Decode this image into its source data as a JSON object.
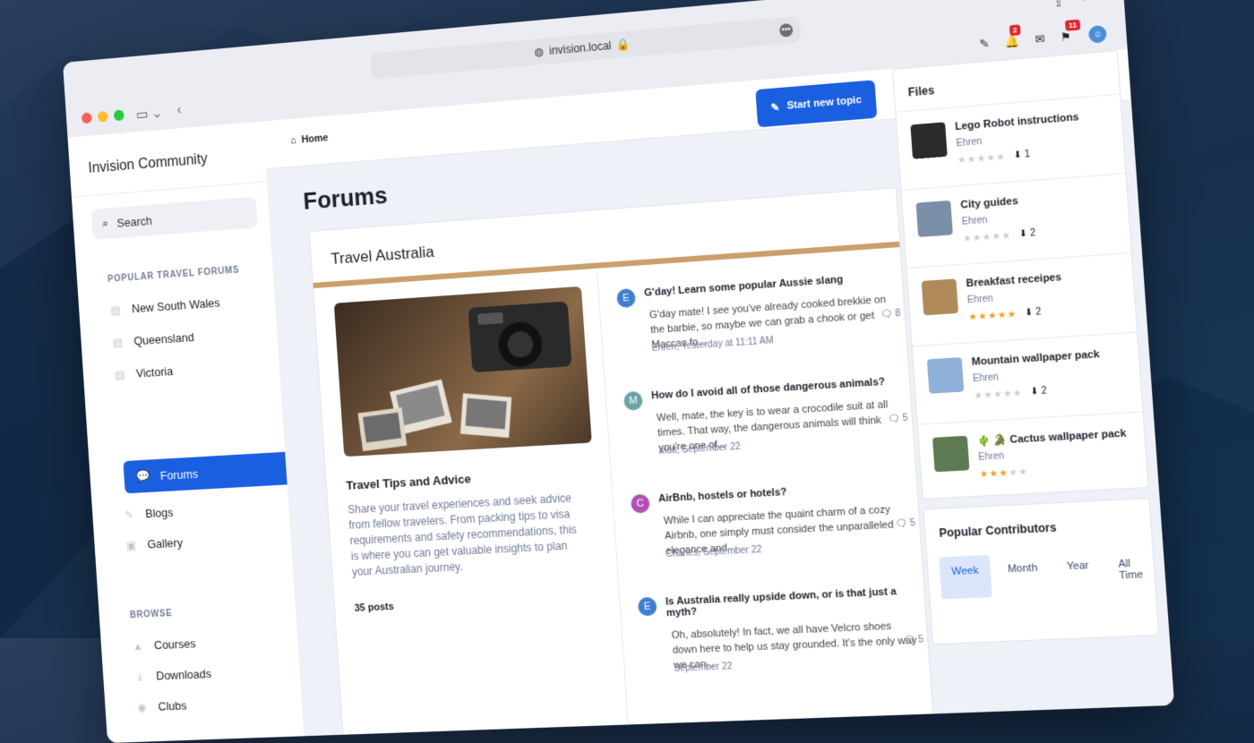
{
  "browser": {
    "url": "invision.local",
    "notifications_count": "2",
    "messages_count": "11"
  },
  "sidebar": {
    "brand": "Invision Community",
    "search_placeholder": "Search",
    "popular_heading": "POPULAR TRAVEL FORUMS",
    "popular": [
      "New South Wales",
      "Queensland",
      "Victoria"
    ],
    "primary": [
      "Forums",
      "Blogs",
      "Gallery"
    ],
    "browse_heading": "BROWSE",
    "browse": [
      "Courses",
      "Downloads",
      "Clubs"
    ]
  },
  "main": {
    "breadcrumb": "Home",
    "start_topic": "Start new topic",
    "page_title": "Forums",
    "category": "Travel Australia",
    "forum": {
      "name": "Travel Tips and Advice",
      "description": "Share your travel experiences and seek advice from fellow travelers. From packing tips to visa requirements and safety recommendations, this is where you can get valuable insights to plan your Australian journey.",
      "posts": "35 posts"
    },
    "topics": [
      {
        "title": "G'day! Learn some popular Aussie slang",
        "excerpt": "G'day mate! I see you've already cooked brekkie on the barbie, so maybe we can grab a chook or get Maccas fo...",
        "meta": "Ehren, Yesterday at 11:11 AM",
        "comments": "8",
        "avatar": "E"
      },
      {
        "title": "How do I avoid all of those dangerous animals?",
        "excerpt": "Well, mate, the key is to wear a crocodile suit at all times. That way, the dangerous animals will think you're one of...",
        "meta": "Matt, September 22",
        "comments": "5",
        "avatar": "M"
      },
      {
        "title": "AirBnb, hostels or hotels?",
        "excerpt": "While I can appreciate the quaint charm of a cozy Airbnb, one simply must consider the unparalleled elegance and...",
        "meta": "Charles, September 22",
        "comments": "5",
        "avatar": "C"
      },
      {
        "title": "Is Australia really upside down, or is that just a myth?",
        "excerpt": "Oh, absolutely! In fact, we all have Velcro shoes down here to help us stay grounded. It's the only way we can...",
        "meta": "September 22",
        "comments": "5",
        "avatar": "E"
      }
    ]
  },
  "files": {
    "heading": "Files",
    "items": [
      {
        "name": "Lego Robot instructions",
        "author": "Ehren",
        "rating": 0,
        "downloads": "1",
        "color": "#2b2b2b"
      },
      {
        "name": "City guides",
        "author": "Ehren",
        "rating": 0,
        "downloads": "2",
        "color": "#7a8fa8"
      },
      {
        "name": "Breakfast receipes",
        "author": "Ehren",
        "rating": 5,
        "downloads": "2",
        "color": "#b08a5a"
      },
      {
        "name": "Mountain wallpaper pack",
        "author": "Ehren",
        "rating": 0,
        "downloads": "2",
        "color": "#8fb0d8"
      },
      {
        "name": "🌵 🐊 Cactus wallpaper pack",
        "author": "Ehren",
        "rating": 3,
        "downloads": "",
        "color": "#5e7a52"
      }
    ]
  },
  "contributors": {
    "heading": "Popular Contributors",
    "tabs": [
      "Week",
      "Month",
      "Year",
      "All Time"
    ]
  },
  "colors": {
    "accent": "#1a5fe0",
    "stripe": "#c9a06c",
    "star": "#f29d1a"
  }
}
